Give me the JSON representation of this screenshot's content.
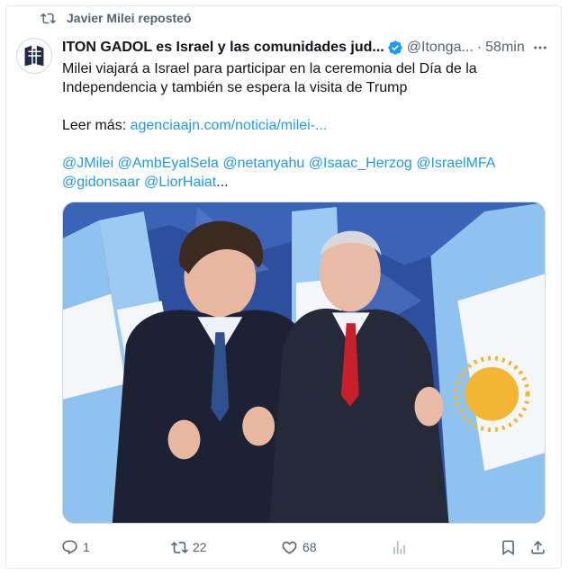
{
  "repost": {
    "label": "Javier Milei reposteó"
  },
  "author": {
    "name": "ITON GADOL es Israel y las comunidades jud...",
    "handle": "@Itonga...",
    "separator": "·",
    "time": "58min"
  },
  "tweet": {
    "text": "Milei viajará a Israel para participar en la ceremonia del Día de la Independencia y también se espera la visita de Trump",
    "read_more_label": "Leer más:",
    "read_more_link": "agenciaajn.com/noticia/milei-...",
    "mentions": [
      "@JMilei",
      "@AmbEyalSela",
      "@netanyahu",
      "@Isaac_Herzog",
      "@IsraelMFA",
      "@gidonsaar",
      "@LiorHaiat"
    ],
    "mentions_ellipsis": "..."
  },
  "actions": {
    "replies": "1",
    "reposts": "22",
    "likes": "68"
  },
  "colors": {
    "link": "#1d9bf0",
    "muted": "#536471",
    "verified": "#1d9bf0"
  },
  "icons": [
    "repost-icon",
    "verified-badge-icon",
    "more-icon",
    "reply-icon",
    "like-icon",
    "views-icon",
    "bookmark-icon",
    "share-icon"
  ]
}
